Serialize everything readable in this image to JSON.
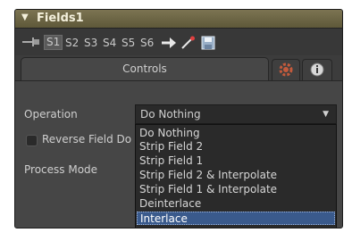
{
  "header": {
    "title": "Fields1"
  },
  "toolbar": {
    "slots": [
      "S1",
      "S2",
      "S3",
      "S4",
      "S5",
      "S6"
    ]
  },
  "tabs": {
    "controls_label": "Controls"
  },
  "operation": {
    "label": "Operation",
    "value": "Do Nothing",
    "options": [
      "Do Nothing",
      "Strip Field 2",
      "Strip Field 1",
      "Strip Field 2 & Interpolate",
      "Strip Field 1 & Interpolate",
      "Deinterlace",
      "Interlace"
    ],
    "highlighted_option": "Interlace"
  },
  "reverse_field": {
    "label": "Reverse Field Do"
  },
  "process_mode": {
    "label": "Process Mode"
  },
  "colors": {
    "header_bg": "#6e6748",
    "panel_bg": "#464646",
    "highlight": "#3a5a8c"
  }
}
